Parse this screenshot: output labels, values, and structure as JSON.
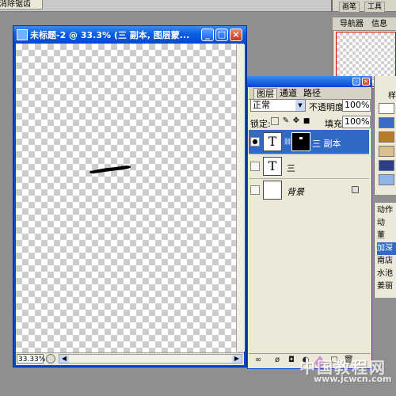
{
  "top_strip": {
    "button_label": "消除锯齿",
    "tabs": [
      "画笔",
      "工具"
    ]
  },
  "navigator": {
    "tabs": [
      "导航器",
      "信息"
    ]
  },
  "document": {
    "title": "未标题-2 @ 33.3% (三 副本, 图层蒙...",
    "zoom": "33.33%",
    "buttons": {
      "minimize": "_",
      "maximize": "□",
      "close": "×"
    }
  },
  "layers_panel": {
    "tabs": [
      "图层",
      "通道",
      "路径"
    ],
    "blend_mode": "正常",
    "opacity_label": "不透明度:",
    "opacity_value": "100%",
    "lock_label": "锁定:",
    "fill_label": "填充:",
    "fill_value": "100%",
    "layers": [
      {
        "name": "三 副本",
        "thumb": "T",
        "visible": true,
        "selected": true,
        "has_mask": true
      },
      {
        "name": "三",
        "thumb": "T",
        "visible": false,
        "selected": false,
        "has_mask": false
      },
      {
        "name": "背景",
        "thumb": "",
        "visible": false,
        "selected": false,
        "has_mask": false,
        "locked": true
      }
    ]
  },
  "swatches_panel": {
    "tab": "样"
  },
  "actions_panel": {
    "items": [
      "动作",
      "动",
      "董",
      "加深",
      "南店",
      "水池",
      "姜丽"
    ]
  },
  "watermark": {
    "text": "中国教程网",
    "url": "www.jcwcn.com"
  },
  "colors": {
    "titlebar_blue": "#0a5ee0",
    "selection_blue": "#316ac5",
    "panel_bg": "#ece9d8",
    "workspace_gray": "#8f8f8f"
  }
}
